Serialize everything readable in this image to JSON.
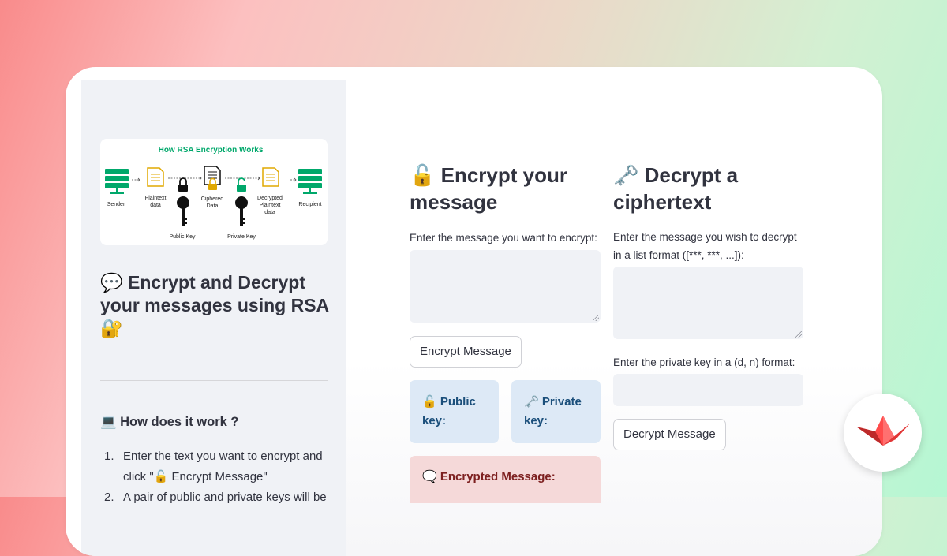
{
  "sidebar": {
    "diagram": {
      "title": "How RSA Encryption Works",
      "labels": {
        "sender": "Sender",
        "plaintext": "Plaintext data",
        "ciphered": "Ciphered Data",
        "decrypted": "Decrypted Plaintext data",
        "recipient": "Recipient",
        "public_key": "Public Key",
        "private_key": "Private Key"
      },
      "accent": "#00a86b"
    },
    "title": "💬 Encrypt and Decrypt your messages using RSA 🔐",
    "how_heading": "💻 How does it work ?",
    "steps": [
      {
        "num": "1.",
        "text": "Enter the text you want to encrypt and click \"🔓 Encrypt Message\""
      },
      {
        "num": "2.",
        "text": "A pair of public and private keys will be"
      }
    ]
  },
  "encrypt": {
    "heading": "🔓 Encrypt your message",
    "input_label": "Enter the message you want to encrypt:",
    "input_value": "",
    "button": "Encrypt Message",
    "public_key_label": "🔓 Public key:",
    "private_key_label": "🗝️ Private key:",
    "encrypted_label": "🗨️ Encrypted Message:"
  },
  "decrypt": {
    "heading": "🗝️ Decrypt a ciphertext",
    "input_label": "Enter the message you wish to decrypt in a list format ([***, ***, ...]):",
    "input_value": "",
    "key_label": "Enter the private key in a (d, n) format:",
    "key_value": "",
    "button": "Decrypt Message"
  },
  "colors": {
    "logo_red": "#ff4b4b",
    "info_bg": "#dde9f6",
    "error_bg": "#f5d9d9"
  }
}
